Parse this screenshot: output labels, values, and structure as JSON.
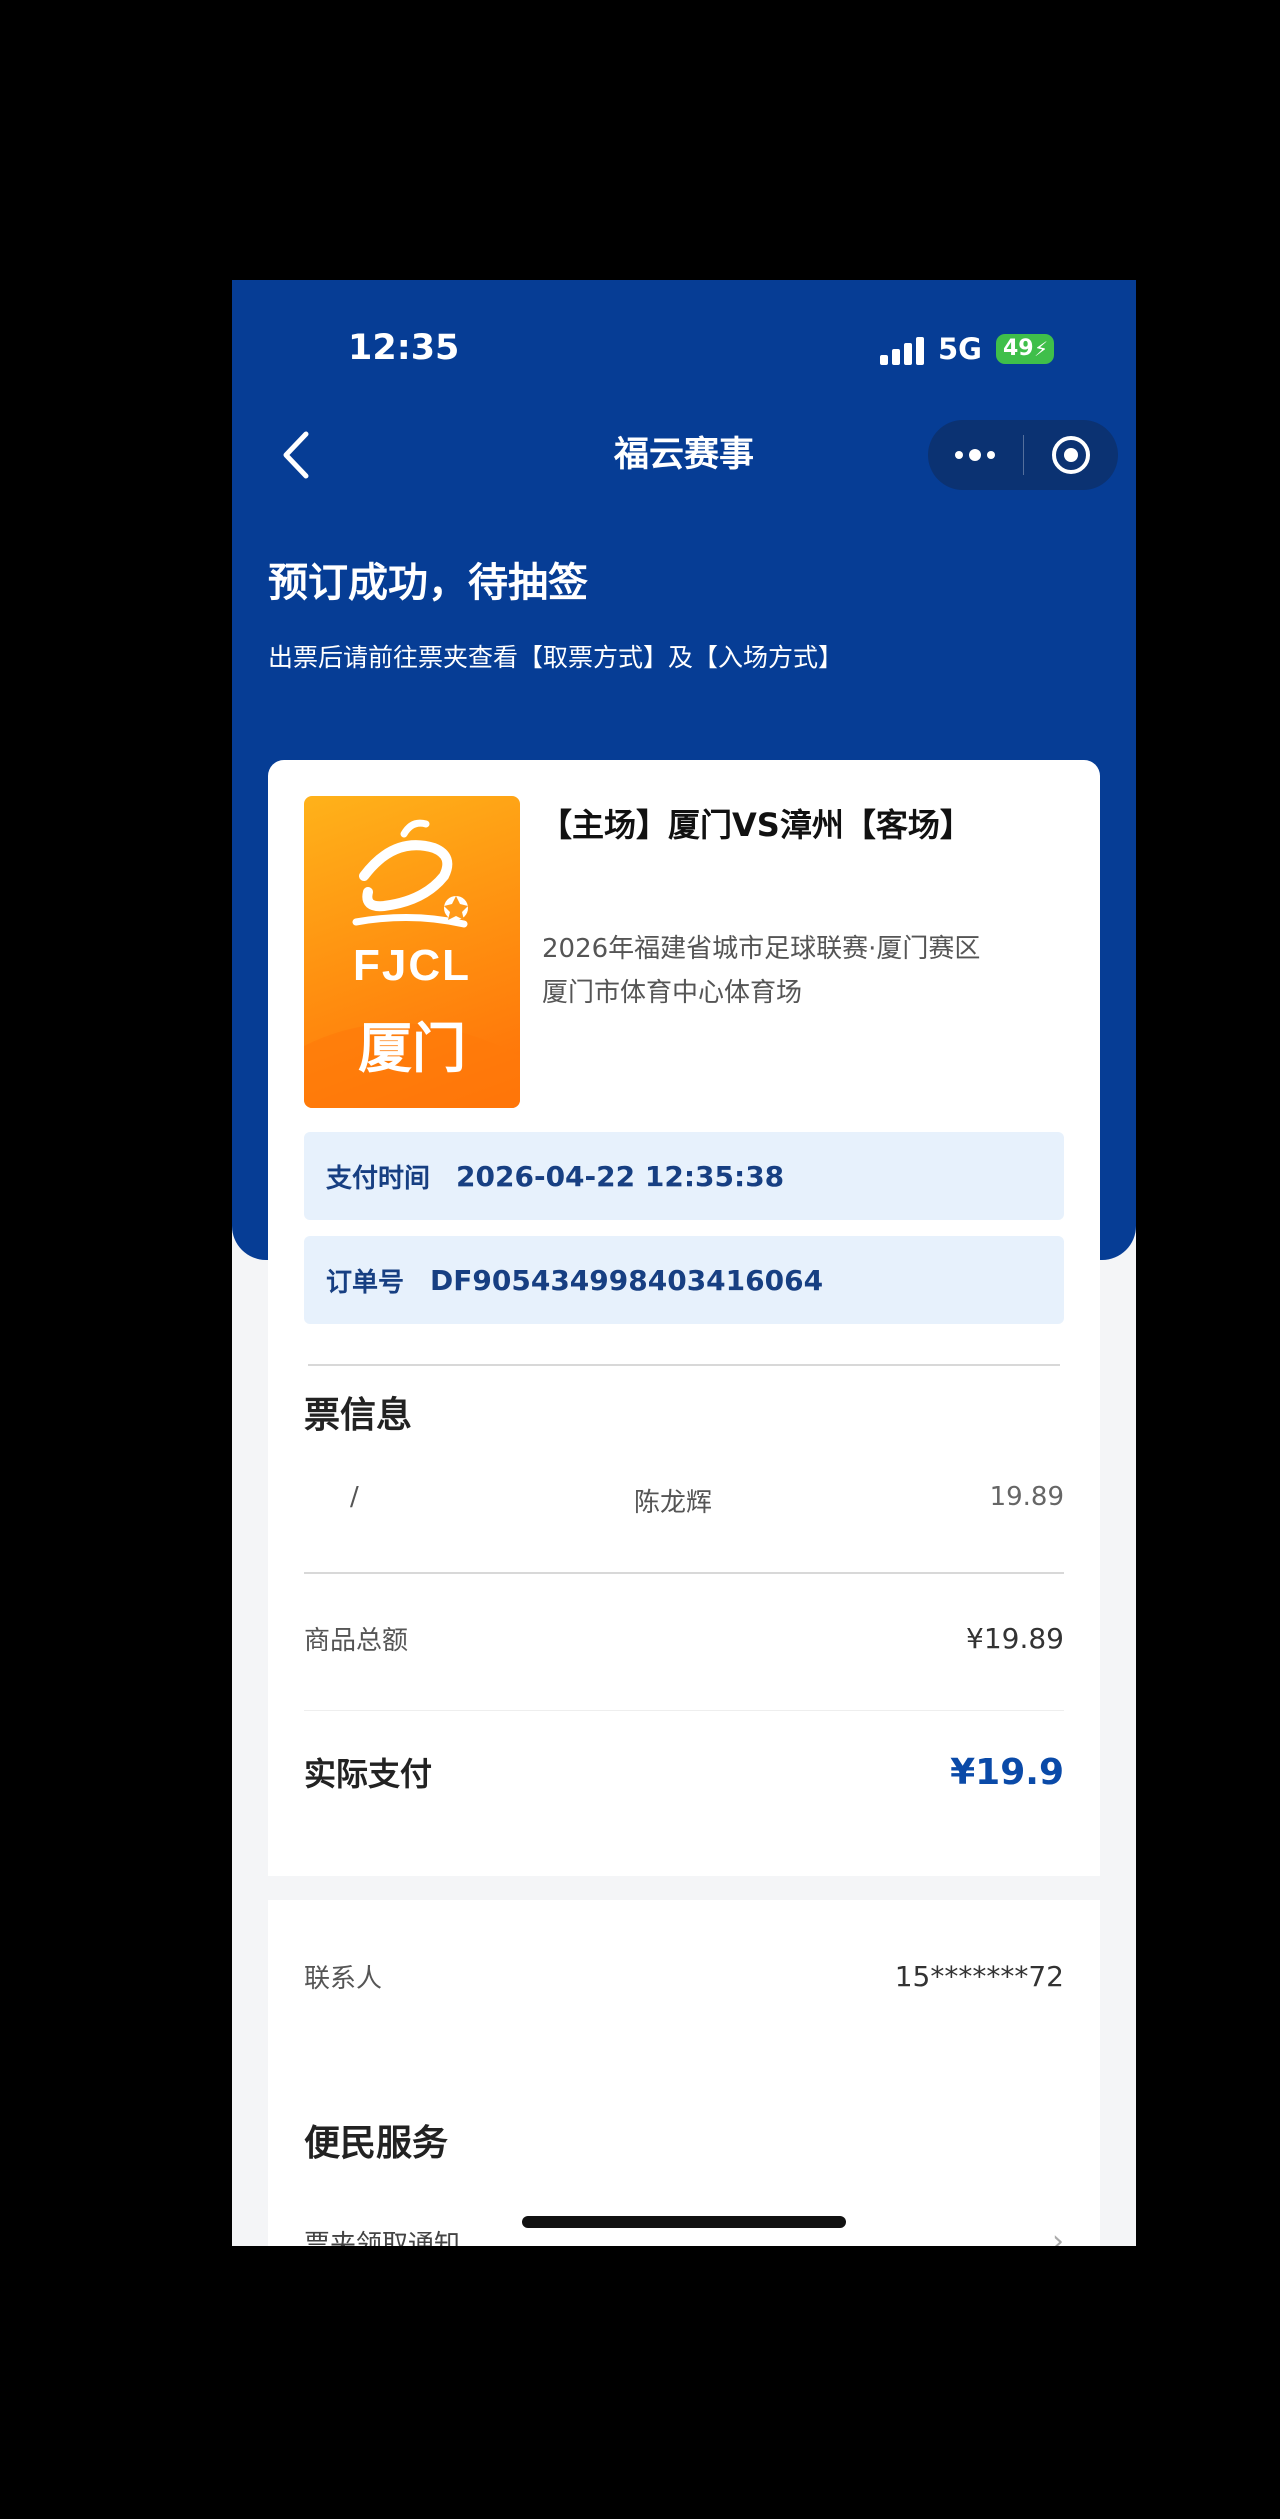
{
  "status_bar": {
    "time": "12:35",
    "network": "5G",
    "battery": "49"
  },
  "nav": {
    "title": "福云赛事"
  },
  "banner": {
    "headline": "预订成功，待抽签",
    "subline": "出票后请前往票夹查看【取票方式】及【入场方式】"
  },
  "event": {
    "poster_brand": "FJCL",
    "poster_city": "厦门",
    "title": "【主场】厦门VS漳州【客场】",
    "league": "2026年福建省城市足球联赛·厦门赛区",
    "venue": "厦门市体育中心体育场"
  },
  "order": {
    "pay_time_label": "支付时间",
    "pay_time_value": "2026-04-22 12:35:38",
    "order_no_label": "订单号",
    "order_no_value": "DF905434998403416064"
  },
  "tickets": {
    "section_title": "票信息",
    "items": [
      {
        "seat": "/",
        "name": "陈龙辉",
        "price": "19.89"
      }
    ]
  },
  "summary": {
    "goods_total_label": "商品总额",
    "goods_total_value": "¥19.89",
    "actual_pay_label": "实际支付",
    "actual_pay_value": "¥19.9"
  },
  "contact": {
    "label": "联系人",
    "value": "15*******72"
  },
  "services": {
    "section_title": "便民服务",
    "first_item": "票夹领取通知"
  },
  "colors": {
    "brand_blue": "#063d95",
    "accent_blue": "#0a4aa8",
    "info_bg": "#e7f1fc",
    "poster_orange": "#ff9010"
  }
}
